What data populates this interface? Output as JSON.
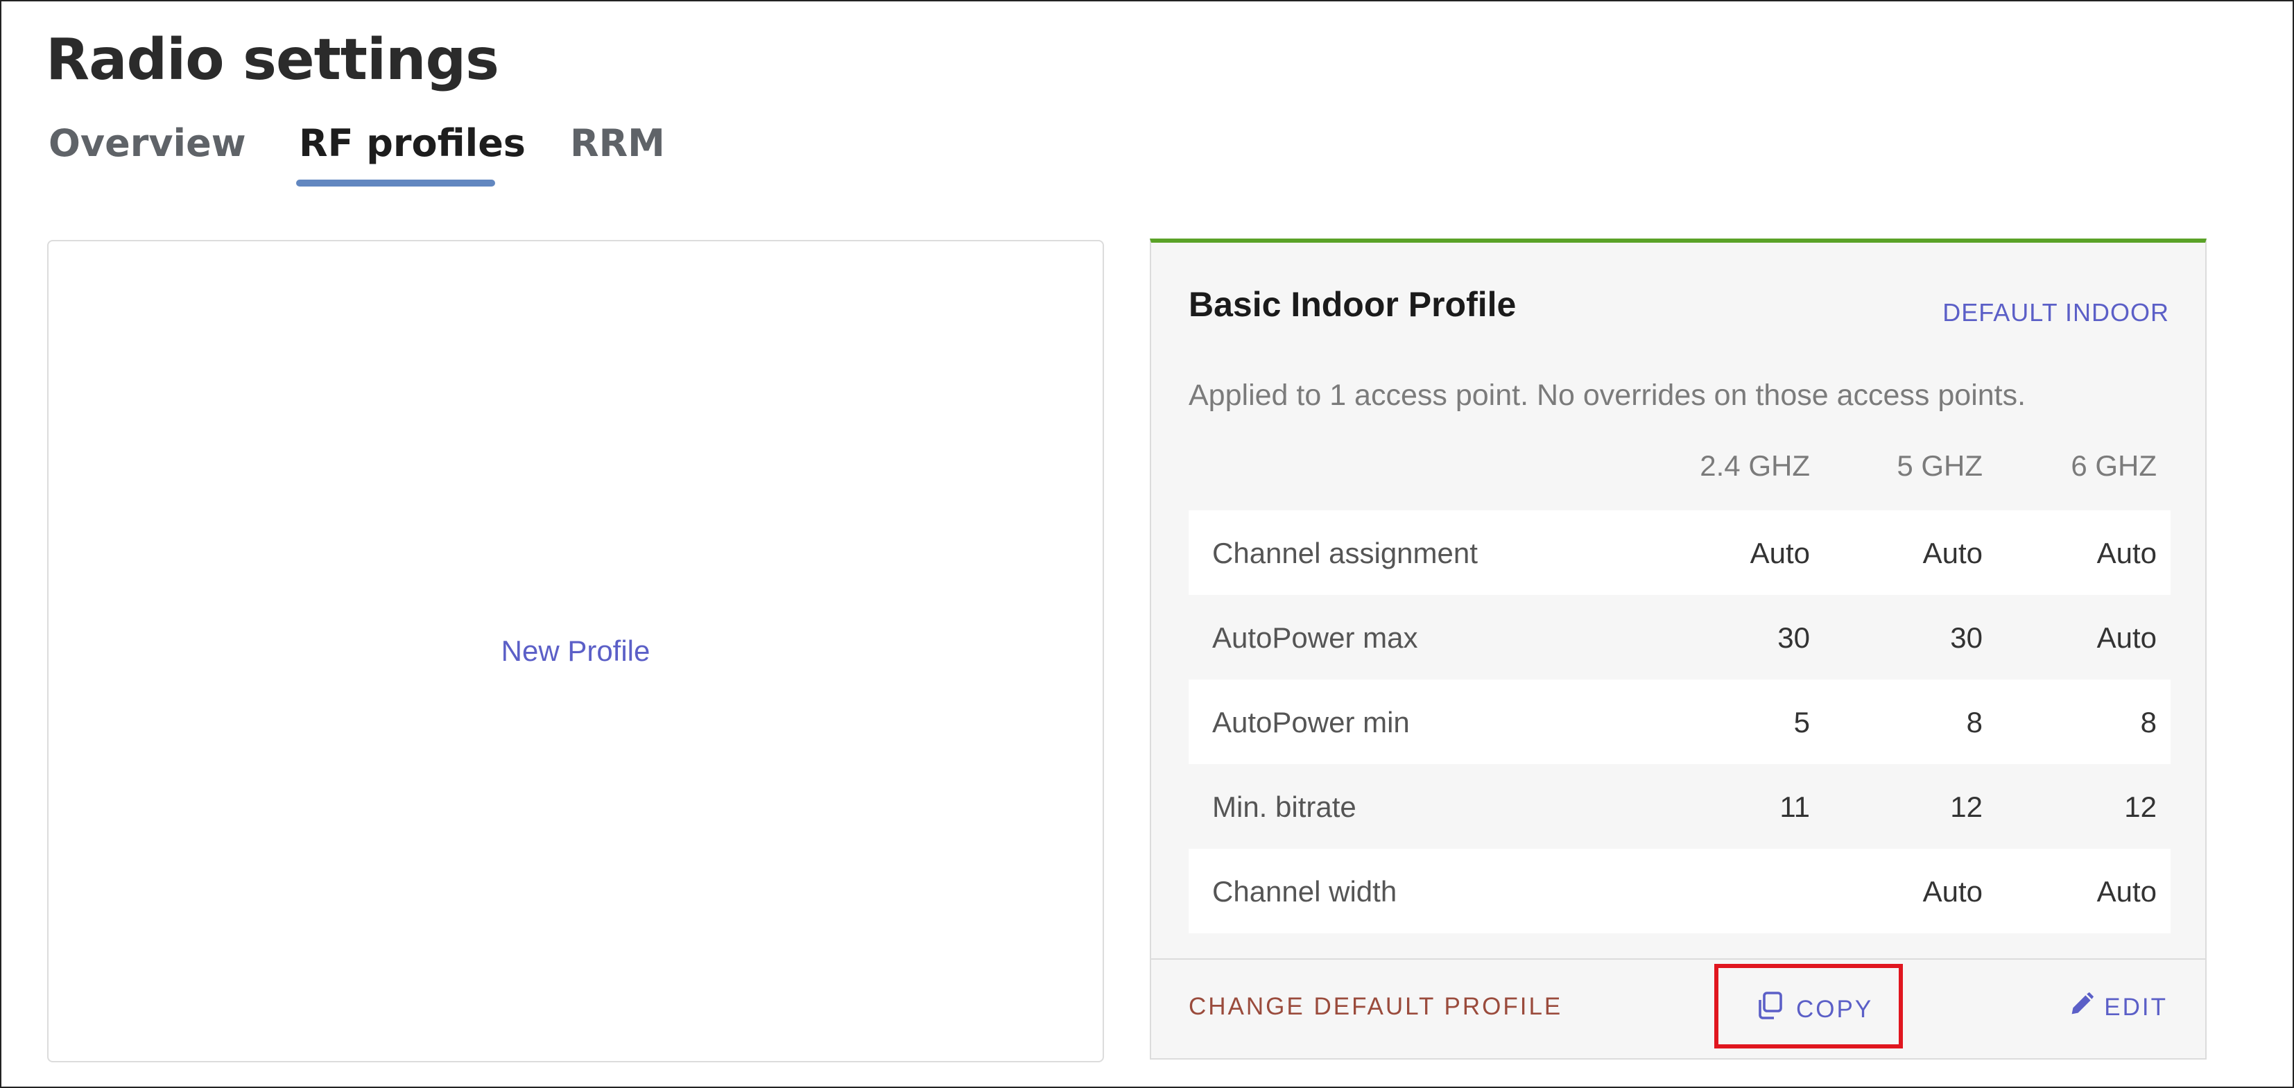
{
  "page": {
    "title": "Radio settings"
  },
  "tabs": [
    {
      "label": "Overview",
      "active": false
    },
    {
      "label": "RF profiles",
      "active": true
    },
    {
      "label": "RRM",
      "active": false
    }
  ],
  "new_profile": {
    "label": "New Profile"
  },
  "profile": {
    "title": "Basic Indoor Profile",
    "badge": "DEFAULT INDOOR",
    "applied_text": "Applied to 1 access point. No overrides on those access points.",
    "bands": [
      "2.4 GHZ",
      "5 GHZ",
      "6 GHZ"
    ],
    "rows": [
      {
        "label": "Channel assignment",
        "values": [
          "Auto",
          "Auto",
          "Auto"
        ]
      },
      {
        "label": "AutoPower max",
        "values": [
          "30",
          "30",
          "Auto"
        ]
      },
      {
        "label": "AutoPower min",
        "values": [
          "5",
          "8",
          "8"
        ]
      },
      {
        "label": "Min. bitrate",
        "values": [
          "11",
          "12",
          "12"
        ]
      },
      {
        "label": "Channel width",
        "values": [
          "",
          "Auto",
          "Auto"
        ]
      }
    ],
    "footer": {
      "change_default": "CHANGE DEFAULT PROFILE",
      "copy": "COPY",
      "edit": "EDIT"
    }
  },
  "icons": {
    "copy": "copy-icon",
    "edit": "pencil-icon"
  },
  "colors": {
    "accent": "#5b5fc7",
    "active_tab_underline": "#6287c0",
    "card_top_border": "#5aa227",
    "highlight": "#e0161f",
    "change_default": "#9a4b3c"
  }
}
